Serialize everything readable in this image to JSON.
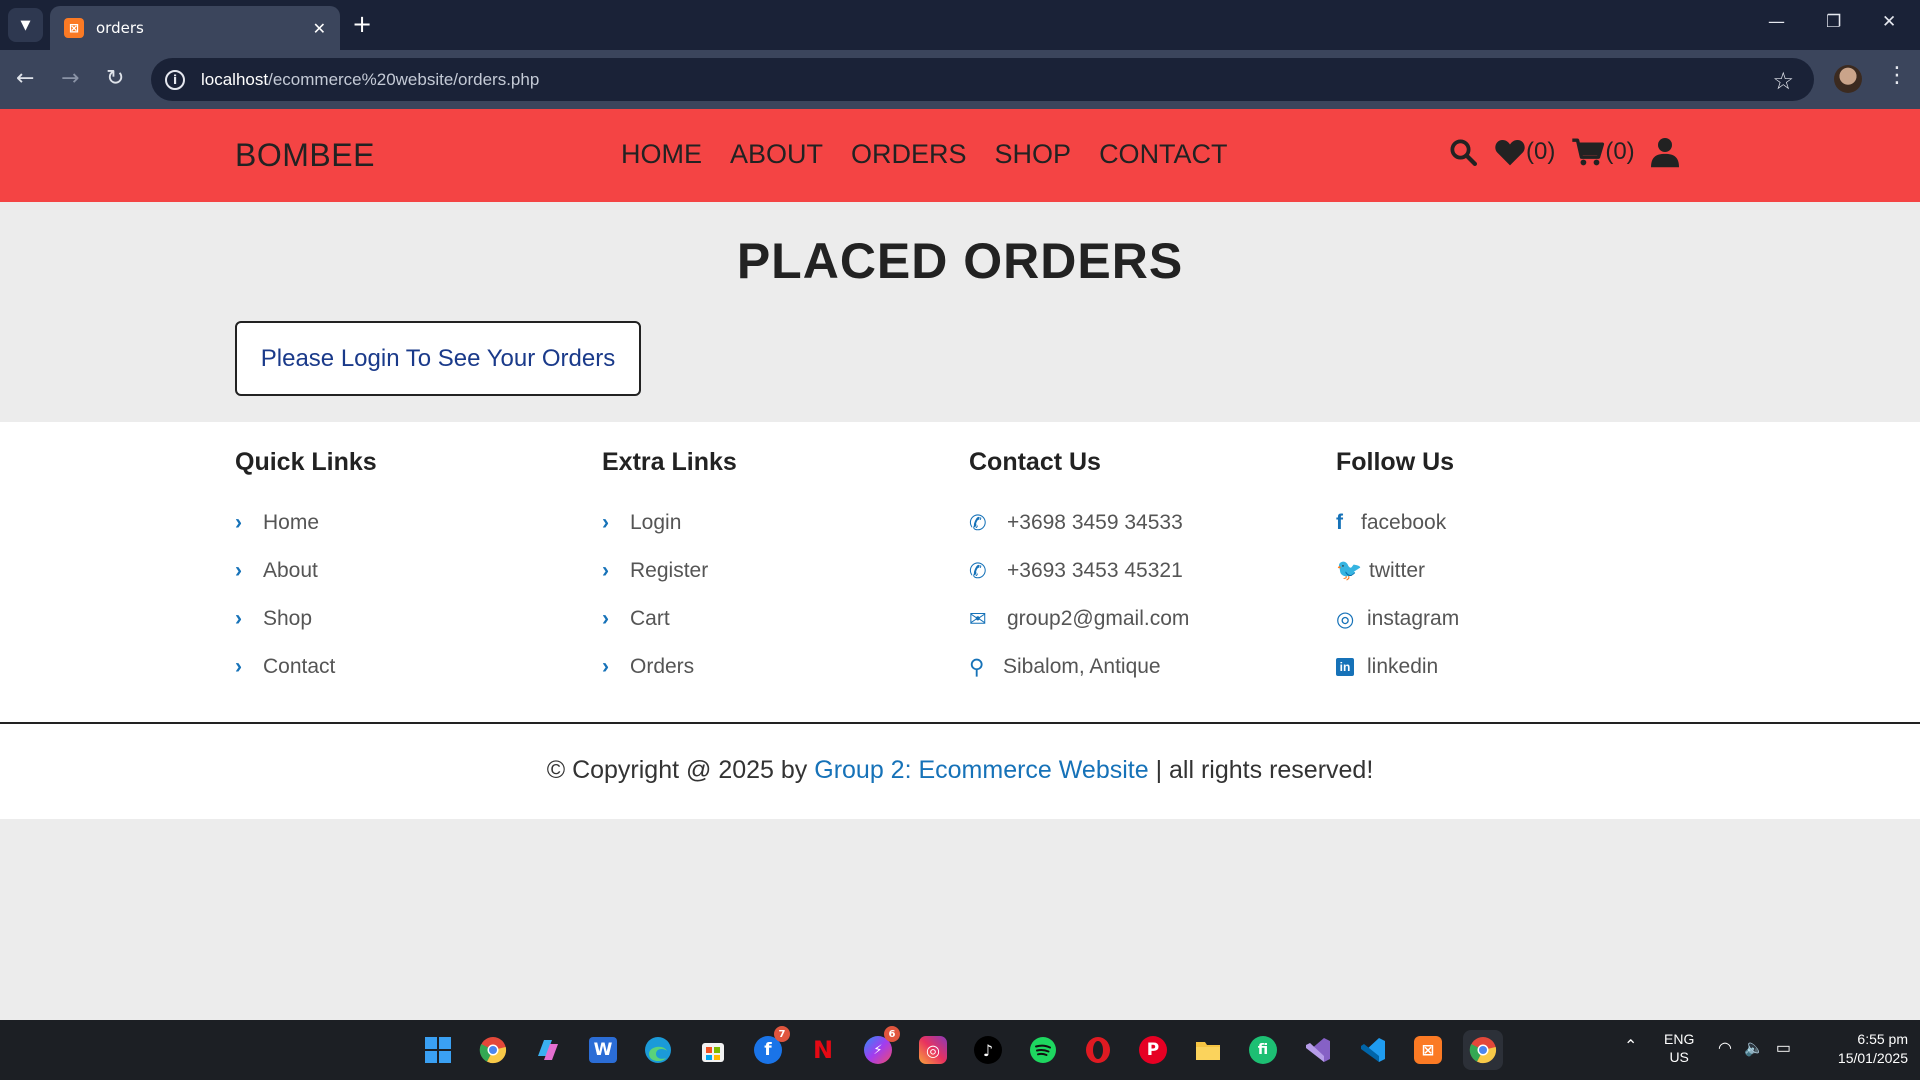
{
  "browser": {
    "tab_title": "orders",
    "favicon_glyph": "⊠",
    "url_host": "localhost",
    "url_path": "/ecommerce%20website/orders.php"
  },
  "site": {
    "logo": "BOMBEE",
    "nav": [
      "HOME",
      "ABOUT",
      "ORDERS",
      "SHOP",
      "CONTACT"
    ],
    "wishlist_count": "(0)",
    "cart_count": "(0)",
    "brand_color": "#f44444",
    "accent_color": "#1672b8"
  },
  "main": {
    "title": "PLACED ORDERS",
    "login_message": "Please Login To See Your Orders"
  },
  "footer": {
    "quick_links": {
      "heading": "Quick Links",
      "items": [
        "Home",
        "About",
        "Shop",
        "Contact"
      ]
    },
    "extra_links": {
      "heading": "Extra Links",
      "items": [
        "Login",
        "Register",
        "Cart",
        "Orders"
      ]
    },
    "contact": {
      "heading": "Contact Us",
      "items": [
        {
          "icon": "phone-icon",
          "text": "+3698 3459 34533"
        },
        {
          "icon": "phone-icon",
          "text": "+3693 3453 45321"
        },
        {
          "icon": "envelope-icon",
          "text": "group2@gmail.com"
        },
        {
          "icon": "map-pin-icon",
          "text": "Sibalom, Antique"
        }
      ]
    },
    "follow": {
      "heading": "Follow Us",
      "items": [
        {
          "icon": "facebook-icon",
          "text": "facebook"
        },
        {
          "icon": "twitter-icon",
          "text": "twitter"
        },
        {
          "icon": "instagram-icon",
          "text": "instagram"
        },
        {
          "icon": "linkedin-icon",
          "text": "linkedin"
        }
      ]
    },
    "copyright_prefix": "© Copyright @ 2025 by ",
    "copyright_brand": "Group 2: Ecommerce Website",
    "copyright_suffix": " | all rights reserved!"
  },
  "taskbar": {
    "badges": {
      "facebook": "7",
      "messenger": "6"
    },
    "lang_top": "ENG",
    "lang_bottom": "US",
    "time": "6:55 pm",
    "date": "15/01/2025"
  }
}
